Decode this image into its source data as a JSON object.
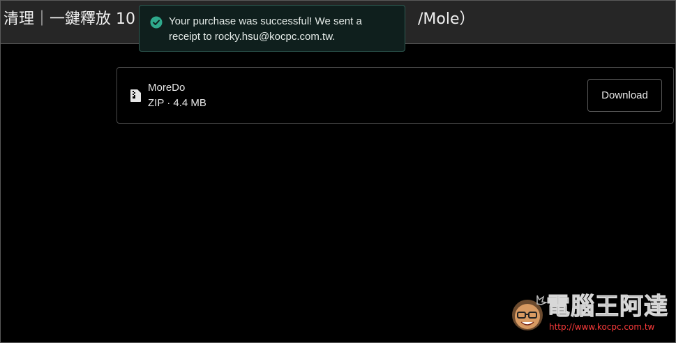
{
  "header": {
    "title_left": "清理｜一鍵釋放 10",
    "title_right": "/Mole）"
  },
  "toast": {
    "message_line1": "Your purchase was successful! We sent a",
    "message_line2": "receipt to rocky.hsu@kocpc.com.tw.",
    "icon": "check-circle-icon",
    "accent_color": "#2fa98c"
  },
  "file": {
    "name": "MoreDo",
    "meta": "ZIP · 4.4 MB",
    "icon": "zip-file-icon",
    "download_label": "Download"
  },
  "watermark": {
    "title": "電腦王阿達",
    "url": "http://www.kocpc.com.tw"
  }
}
